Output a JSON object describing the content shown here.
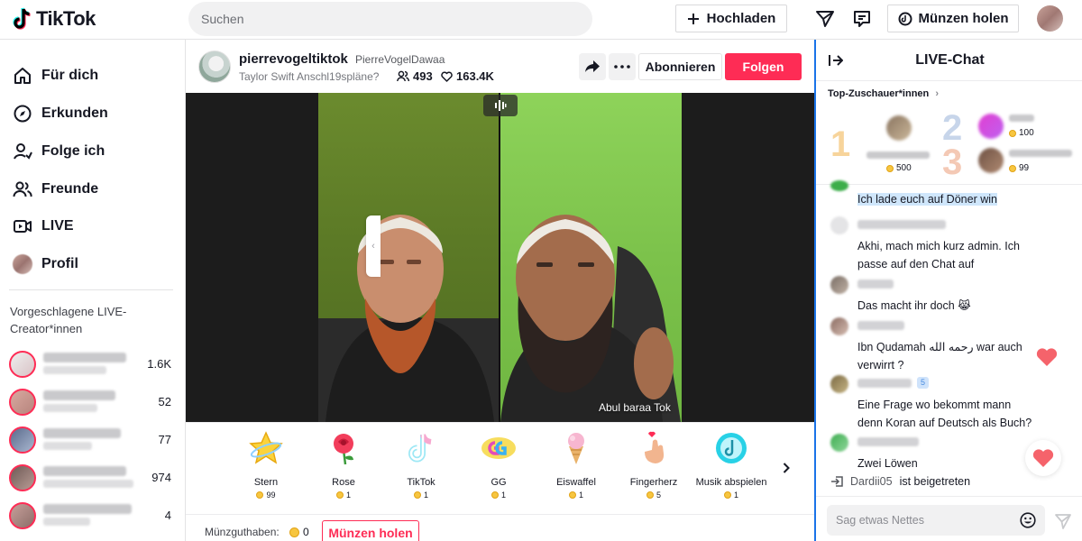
{
  "app": {
    "name": "TikTok"
  },
  "header": {
    "search_placeholder": "Suchen",
    "upload_label": "Hochladen",
    "coins_label": "Münzen holen"
  },
  "sidebar": {
    "nav": [
      {
        "label": "Für dich",
        "icon": "home-icon"
      },
      {
        "label": "Erkunden",
        "icon": "compass-icon"
      },
      {
        "label": "Folge ich",
        "icon": "following-icon"
      },
      {
        "label": "Freunde",
        "icon": "friends-icon"
      },
      {
        "label": "LIVE",
        "icon": "live-icon"
      },
      {
        "label": "Profil",
        "icon": "profile-avatar"
      }
    ],
    "suggested_heading": "Vorgeschlagene LIVE-Creator*innen",
    "suggested_counts": [
      "1.6K",
      "52",
      "77",
      "974",
      "4"
    ]
  },
  "stream": {
    "handle": "pierrevogeltiktok",
    "nickname": "PierreVogelDawaa",
    "title": "Taylor Swift Anschl19spläne?",
    "viewers": "493",
    "likes": "163.4K",
    "subscribe_label": "Abonnieren",
    "follow_label": "Folgen",
    "caption": "Abul baraa Tok"
  },
  "gifts": [
    {
      "name": "Stern",
      "price": "99",
      "icon": "star-gift-icon"
    },
    {
      "name": "Rose",
      "price": "1",
      "icon": "rose-gift-icon"
    },
    {
      "name": "TikTok",
      "price": "1",
      "icon": "tiktok-gift-icon"
    },
    {
      "name": "GG",
      "price": "1",
      "icon": "gg-gift-icon"
    },
    {
      "name": "Eiswaffel",
      "price": "1",
      "icon": "ice-cream-gift-icon"
    },
    {
      "name": "Fingerherz",
      "price": "5",
      "icon": "finger-heart-gift-icon"
    },
    {
      "name": "Musik abspielen",
      "price": "1",
      "icon": "music-gift-icon"
    }
  ],
  "balance": {
    "label": "Münzguthaben:",
    "value": "0",
    "button": "Münzen holen"
  },
  "chat": {
    "title": "LIVE-Chat",
    "top_viewers_label": "Top-Zuschauer*innen",
    "ranks": [
      {
        "rank": "1",
        "coins": "500"
      },
      {
        "rank": "2",
        "coins": "100"
      },
      {
        "rank": "3",
        "coins": "99"
      }
    ],
    "messages": [
      {
        "text": "Ich lade euch auf Döner win",
        "highlight": true
      },
      {
        "text": "Akhi, mach mich kurz admin. Ich passe auf den Chat auf"
      },
      {
        "text": "Das macht ihr doch 😹"
      },
      {
        "text": "Ibn Qudamah رحمه الله war auch verwirrt ?"
      },
      {
        "text": "Eine Frage wo bekommt mann denn Koran auf Deutsch als Buch?"
      },
      {
        "text": "Zwei Löwen"
      }
    ],
    "badge": "5",
    "joined": {
      "user": "Dardii05",
      "text": "ist beigetreten"
    },
    "input_placeholder": "Sag etwas Nettes"
  },
  "colors": {
    "accent": "#fe2c55",
    "coin": "#f7c640",
    "highlight": "#cfe6fb"
  }
}
